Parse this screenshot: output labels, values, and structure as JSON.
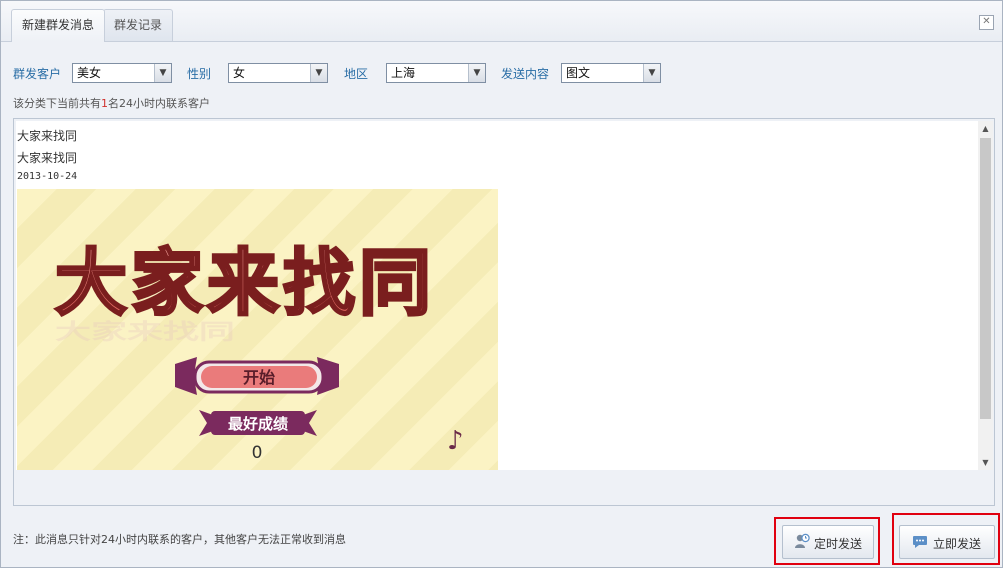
{
  "tabs": [
    "新建群发消息",
    "群发记录"
  ],
  "close_icon": "close-icon",
  "filters": {
    "customer_label": "群发客户",
    "customer_value": "美女",
    "gender_label": "性别",
    "gender_value": "女",
    "region_label": "地区",
    "region_value": "上海",
    "content_label": "发送内容",
    "content_value": "图文"
  },
  "count_text": {
    "prefix": "该分类下当前共有",
    "number": "1",
    "suffix": "名24小时内联系客户"
  },
  "preview": {
    "title1": "大家来找同",
    "title2": "大家来找同",
    "date": "2013-10-24",
    "game_title": "大家来找同",
    "start_label": "开始",
    "best_label": "最好成绩",
    "score": "0"
  },
  "note": "注：此消息只针对24小时内联系的客户，其他客户无法正常收到消息",
  "buttons": {
    "scheduled": "定时发送",
    "send_now": "立即发送"
  },
  "colors": {
    "label_blue": "#2a6ea6",
    "highlight_red": "#e0000f",
    "count_red": "#d0302c"
  }
}
